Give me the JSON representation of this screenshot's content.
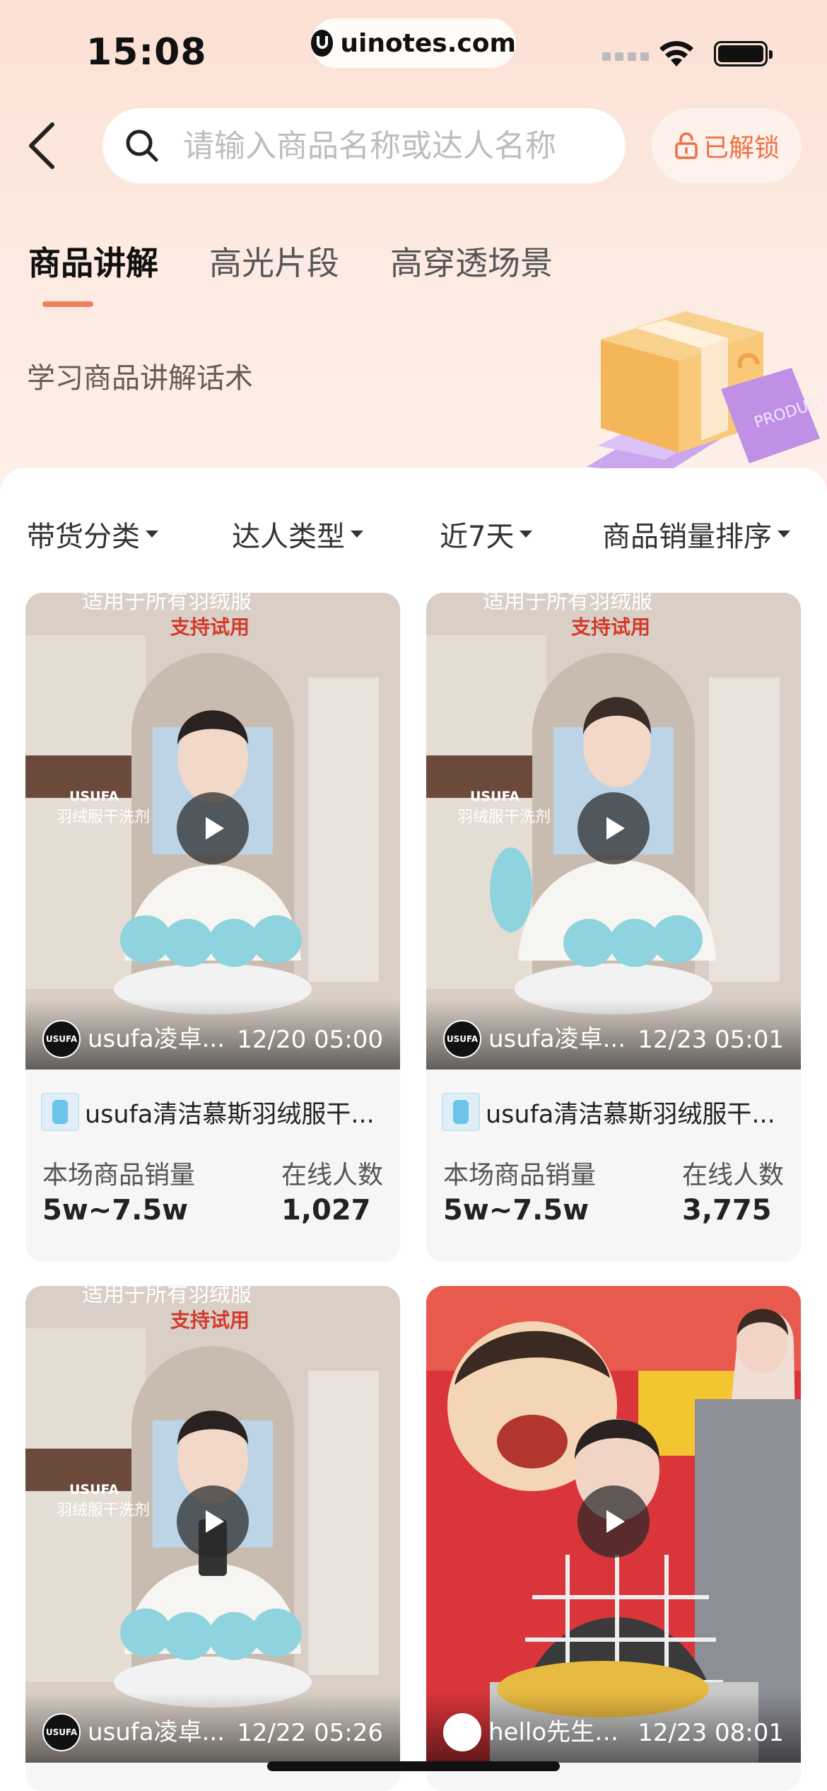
{
  "status_bar": {
    "time": "15:08",
    "url": "uinotes.com"
  },
  "nav": {
    "search_placeholder": "请输入商品名称或达人名称",
    "unlock_label": "已解锁"
  },
  "tabs": [
    {
      "label": "商品讲解",
      "active": true
    },
    {
      "label": "高光片段",
      "active": false
    },
    {
      "label": "高穿透场景",
      "active": false
    }
  ],
  "subtitle": "学习商品讲解话术",
  "illustration_text": "PRODUCT",
  "filters": [
    {
      "label": "带货分类"
    },
    {
      "label": "达人类型"
    },
    {
      "label": "近7天"
    },
    {
      "label": "商品销量排序"
    }
  ],
  "cards": [
    {
      "banner_top": "适用于所有羽绒服",
      "banner_sub": "支持试用",
      "brand": "USUFA",
      "brand_sub": "羽绒服干洗剂",
      "avatar_text": "USUFA",
      "author": "usufa凌卓...",
      "date": "12/20 05:00",
      "product_name": "usufa清洁慕斯羽绒服干...",
      "sales_label": "本场商品销量",
      "sales_value": "5w~7.5w",
      "online_label": "在线人数",
      "online_value": "1,027"
    },
    {
      "banner_top": "适用于所有羽绒服",
      "banner_sub": "支持试用",
      "brand": "USUFA",
      "brand_sub": "羽绒服干洗剂",
      "avatar_text": "USUFA",
      "author": "usufa凌卓...",
      "date": "12/23 05:01",
      "product_name": "usufa清洁慕斯羽绒服干...",
      "sales_label": "本场商品销量",
      "sales_value": "5w~7.5w",
      "online_label": "在线人数",
      "online_value": "3,775"
    },
    {
      "banner_top": "适用于所有羽绒服",
      "banner_sub": "支持试用",
      "brand": "USUFA",
      "brand_sub": "羽绒服干洗剂",
      "avatar_text": "USUFA",
      "author": "usufa凌卓...",
      "date": "12/22 05:26"
    },
    {
      "avatar_text": "",
      "author": "hello先生🍀...",
      "date": "12/23 08:01"
    }
  ],
  "colors": {
    "accent": "#ee7f5f",
    "unlock": "#ef7044",
    "header_bg": "#fbe0d3"
  }
}
